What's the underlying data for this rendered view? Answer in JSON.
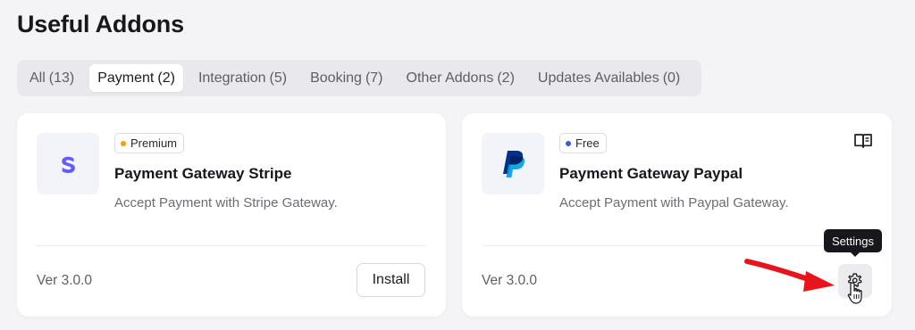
{
  "page": {
    "title": "Useful Addons"
  },
  "tabs": [
    {
      "label": "All",
      "count": "(13)",
      "active": false
    },
    {
      "label": "Payment",
      "count": "(2)",
      "active": true
    },
    {
      "label": "Integration",
      "count": "(5)",
      "active": false
    },
    {
      "label": "Booking",
      "count": "(7)",
      "active": false
    },
    {
      "label": "Other Addons",
      "count": "(2)",
      "active": false
    },
    {
      "label": "Updates Availables",
      "count": "(0)",
      "active": false
    }
  ],
  "addons": [
    {
      "logo_icon": "stripe-logo",
      "badge": "Premium",
      "badge_color": "#f59e0b",
      "title": "Payment Gateway Stripe",
      "description": "Accept Payment with Stripe Gateway.",
      "version": "Ver 3.0.0",
      "action_label": "Install"
    },
    {
      "logo_icon": "paypal-logo",
      "badge": "Free",
      "badge_color": "#3b5bdb",
      "title": "Payment Gateway Paypal",
      "description": "Accept Payment with Paypal Gateway.",
      "version": "Ver 3.0.0",
      "docs_icon": "book-open-icon",
      "settings_icon": "gear-icon"
    }
  ],
  "tooltip": {
    "text": "Settings"
  },
  "colors": {
    "stripe_brand": "#635bff",
    "paypal_dark": "#003087",
    "paypal_light": "#009cde",
    "annotation_arrow": "#e8141b"
  }
}
